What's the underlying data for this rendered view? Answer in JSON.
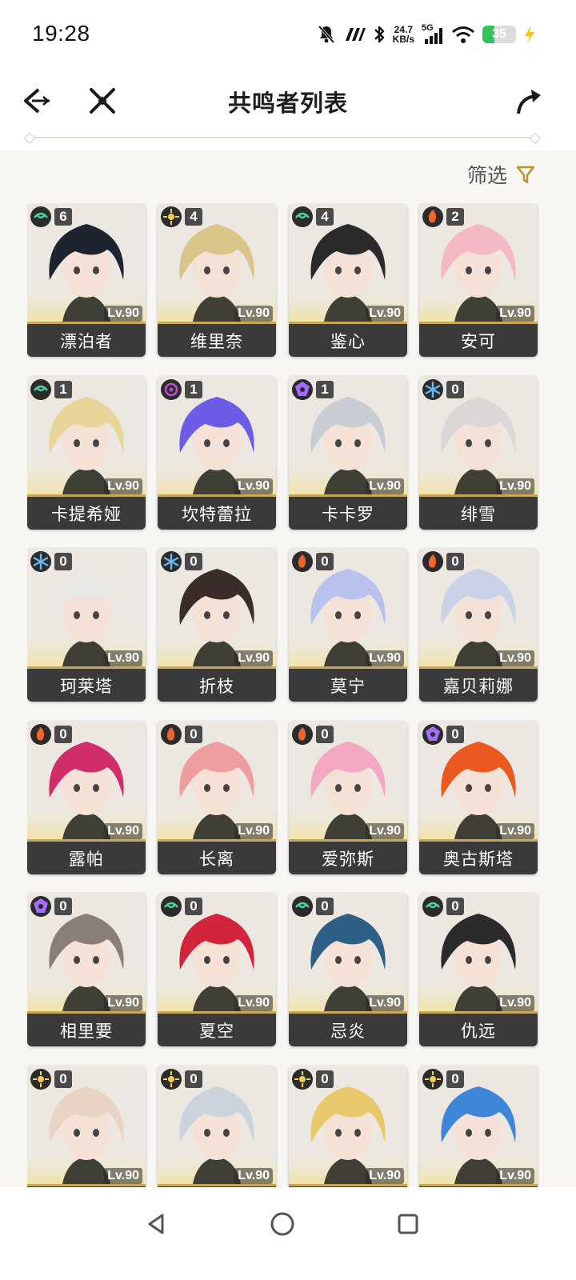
{
  "status_bar": {
    "time": "19:28",
    "net_speed_value": "24.7",
    "net_speed_unit": "KB/s",
    "signal_label": "5G",
    "battery_level": "35",
    "icons": [
      "mute-icon",
      "carrier-logo-icon",
      "bluetooth-icon",
      "signal-icon",
      "wifi-icon",
      "battery-icon",
      "charging-icon"
    ]
  },
  "header": {
    "title": "共鸣者列表",
    "back_icon": "back-arrow-icon",
    "special_icon": "crossed-swords-icon",
    "share_icon": "share-icon"
  },
  "filter": {
    "label": "筛选",
    "icon": "filter-icon"
  },
  "colors": {
    "aero": "#4fd6a0",
    "spectro": "#f1cf57",
    "havoc": "#c04bd6",
    "fusion": "#f0652e",
    "glacio": "#63b8f3",
    "electro": "#a46bff",
    "name_bar": "#3a3a3a",
    "accent_gold": "#c7a75a"
  },
  "characters": [
    {
      "name": "漂泊者",
      "element": "aero",
      "sequence": "6",
      "level": "Lv.90"
    },
    {
      "name": "维里奈",
      "element": "spectro",
      "sequence": "4",
      "level": "Lv.90"
    },
    {
      "name": "鉴心",
      "element": "aero",
      "sequence": "4",
      "level": "Lv.90"
    },
    {
      "name": "安可",
      "element": "fusion",
      "sequence": "2",
      "level": "Lv.90"
    },
    {
      "name": "卡提希娅",
      "element": "aero",
      "sequence": "1",
      "level": "Lv.90"
    },
    {
      "name": "坎特蕾拉",
      "element": "havoc",
      "sequence": "1",
      "level": "Lv.90"
    },
    {
      "name": "卡卡罗",
      "element": "electro",
      "sequence": "1",
      "level": "Lv.90"
    },
    {
      "name": "绯雪",
      "element": "glacio",
      "sequence": "0",
      "level": "Lv.90"
    },
    {
      "name": "珂莱塔",
      "element": "glacio",
      "sequence": "0",
      "level": "Lv.90"
    },
    {
      "name": "折枝",
      "element": "glacio",
      "sequence": "0",
      "level": "Lv.90"
    },
    {
      "name": "莫宁",
      "element": "fusion",
      "sequence": "0",
      "level": "Lv.90"
    },
    {
      "name": "嘉贝莉娜",
      "element": "fusion",
      "sequence": "0",
      "level": "Lv.90"
    },
    {
      "name": "露帕",
      "element": "fusion",
      "sequence": "0",
      "level": "Lv.90"
    },
    {
      "name": "长离",
      "element": "fusion",
      "sequence": "0",
      "level": "Lv.90"
    },
    {
      "name": "爱弥斯",
      "element": "fusion",
      "sequence": "0",
      "level": "Lv.90"
    },
    {
      "name": "奥古斯塔",
      "element": "electro",
      "sequence": "0",
      "level": "Lv.90"
    },
    {
      "name": "相里要",
      "element": "electro",
      "sequence": "0",
      "level": "Lv.90"
    },
    {
      "name": "夏空",
      "element": "aero",
      "sequence": "0",
      "level": "Lv.90"
    },
    {
      "name": "忌炎",
      "element": "aero",
      "sequence": "0",
      "level": "Lv.90"
    },
    {
      "name": "仇远",
      "element": "aero",
      "sequence": "0",
      "level": "Lv.90"
    },
    {
      "name": "",
      "element": "spectro",
      "sequence": "0",
      "level": "Lv.90"
    },
    {
      "name": "",
      "element": "spectro",
      "sequence": "0",
      "level": "Lv.90"
    },
    {
      "name": "",
      "element": "spectro",
      "sequence": "0",
      "level": "Lv.90"
    },
    {
      "name": "",
      "element": "spectro",
      "sequence": "0",
      "level": "Lv.90"
    }
  ],
  "nav_bar": {
    "icons": [
      "nav-back-icon",
      "nav-home-icon",
      "nav-recents-icon"
    ]
  }
}
